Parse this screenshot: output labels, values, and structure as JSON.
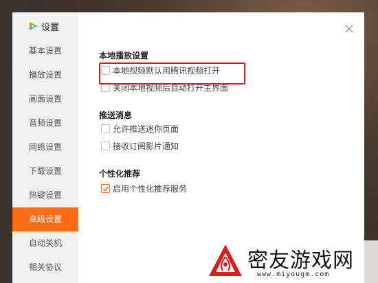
{
  "window": {
    "title": "设置",
    "close_icon": "close-icon"
  },
  "sidebar": {
    "items": [
      {
        "label": "基本设置",
        "active": false
      },
      {
        "label": "播放设置",
        "active": false
      },
      {
        "label": "画面设置",
        "active": false
      },
      {
        "label": "音频设置",
        "active": false
      },
      {
        "label": "网络设置",
        "active": false
      },
      {
        "label": "下载设置",
        "active": false
      },
      {
        "label": "热键设置",
        "active": false
      },
      {
        "label": "高级设置",
        "active": true
      },
      {
        "label": "自动关机",
        "active": false
      },
      {
        "label": "相关协议",
        "active": false
      }
    ]
  },
  "sections": {
    "local_play": {
      "title": "本地播放设置",
      "options": [
        {
          "label": "本地视频默认用腾讯视频打开",
          "checked": false
        },
        {
          "label": "关闭本地视频后自动打开主界面",
          "checked": false
        }
      ]
    },
    "push": {
      "title": "推送消息",
      "options": [
        {
          "label": "允许推送迷你页面",
          "checked": false
        },
        {
          "label": "接收订阅影片通知",
          "checked": false
        }
      ]
    },
    "personal": {
      "title": "个性化推荐",
      "options": [
        {
          "label": "启用个性化推荐服务",
          "checked": true
        }
      ]
    }
  },
  "watermark": {
    "name": "密友游戏网",
    "url": "www.miyougm.com"
  },
  "colors": {
    "accent": "#ff6a13",
    "highlight_box": "#e3111a",
    "sidebar_bg": "#f2f2f2"
  }
}
